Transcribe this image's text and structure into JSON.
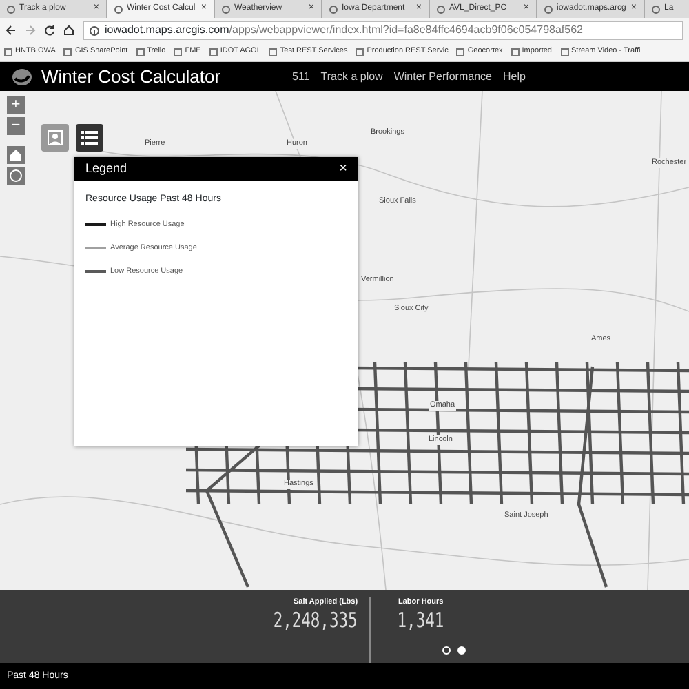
{
  "browser": {
    "tabs": [
      {
        "label": "Track a plow",
        "selected": false,
        "close": "×"
      },
      {
        "label": "Winter Cost Calcul",
        "selected": true,
        "close": "×"
      },
      {
        "label": "Weatherview",
        "selected": false,
        "close": "×"
      },
      {
        "label": "Iowa Department",
        "selected": false,
        "close": "×"
      },
      {
        "label": "AVL_Direct_PC",
        "selected": false,
        "close": "×"
      },
      {
        "label": "iowadot.maps.arcg",
        "selected": false,
        "close": "×"
      },
      {
        "label": "La",
        "selected": false
      }
    ],
    "address": {
      "domain": "iowadot.maps.arcgis.com",
      "path": "/apps/webappviewer/index.html?id=fa8e84ffc4694acb9f06c054798af562"
    },
    "bookmarks": [
      "HNTB OWA",
      "GIS SharePoint",
      "Trello",
      "FME",
      "IDOT AGOL",
      "Test REST Services",
      "Production REST Servic",
      "Geocortex",
      "Imported",
      "Stream Video - Traffi"
    ]
  },
  "app": {
    "title": "Winter Cost Calculator",
    "nav": [
      "511",
      "Track a plow",
      "Winter Performance",
      "Help"
    ]
  },
  "map": {
    "zoom_in": "+",
    "zoom_out": "−",
    "places": [
      "Pierre",
      "Huron",
      "Brookings",
      "Rochester",
      "Sioux Falls",
      "Vermillion",
      "Sioux City",
      "Ames",
      "Omaha",
      "Lincoln",
      "Hastings",
      "Saint Joseph"
    ],
    "legend": {
      "title": "Legend",
      "close": "×",
      "heading": "Resource Usage Past 48 Hours",
      "items": [
        {
          "label": "High Resource Usage",
          "color": "#1a1a1a"
        },
        {
          "label": "Average Resource Usage",
          "color": "#a0a0a0"
        },
        {
          "label": "Low Resource Usage",
          "color": "#5a5a5a"
        }
      ]
    }
  },
  "stats": {
    "items": [
      {
        "label": "Salt Applied (Lbs)",
        "value": "2,248,335"
      },
      {
        "label": "Labor Hours",
        "value": "1,341"
      }
    ],
    "pages": [
      {
        "selected": false
      },
      {
        "selected": true
      }
    ]
  },
  "footer": "Past 48 Hours"
}
